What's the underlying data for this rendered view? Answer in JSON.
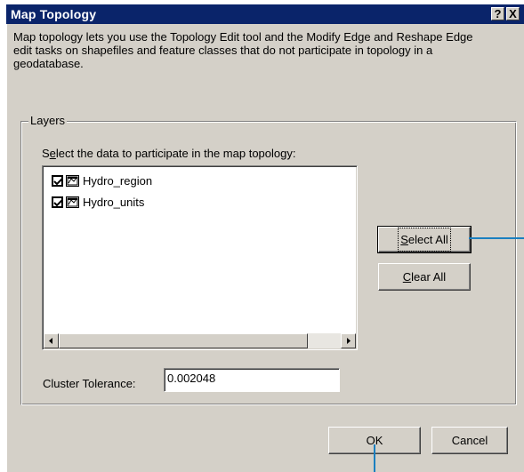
{
  "window": {
    "title": "Map Topology",
    "help_button": "?",
    "close_button": "X"
  },
  "description": "Map topology lets you use the Topology Edit tool and the Modify Edge and Reshape Edge edit tasks on shapefiles and feature classes that do not participate in topology in a geodatabase.",
  "layers_group": {
    "label": "Layers",
    "prompt_pre": "S",
    "prompt_mnemonic": "e",
    "prompt_post": "lect the data to participate in the map topology:",
    "items": [
      {
        "name": "Hydro_region",
        "checked": true
      },
      {
        "name": "Hydro_units",
        "checked": true
      }
    ],
    "select_all_mnemonic": "S",
    "select_all_rest": "elect All",
    "clear_all_mnemonic": "C",
    "clear_all_rest": "lear All",
    "cluster_tolerance_label": "Cluster Tolerance:",
    "cluster_tolerance_value": "0.002048"
  },
  "footer": {
    "ok_label": "OK",
    "cancel_label": "Cancel"
  },
  "colors": {
    "titlebar": "#0a246a",
    "dialog_face": "#d4d0c8",
    "callout_line": "#1a7fc0"
  }
}
